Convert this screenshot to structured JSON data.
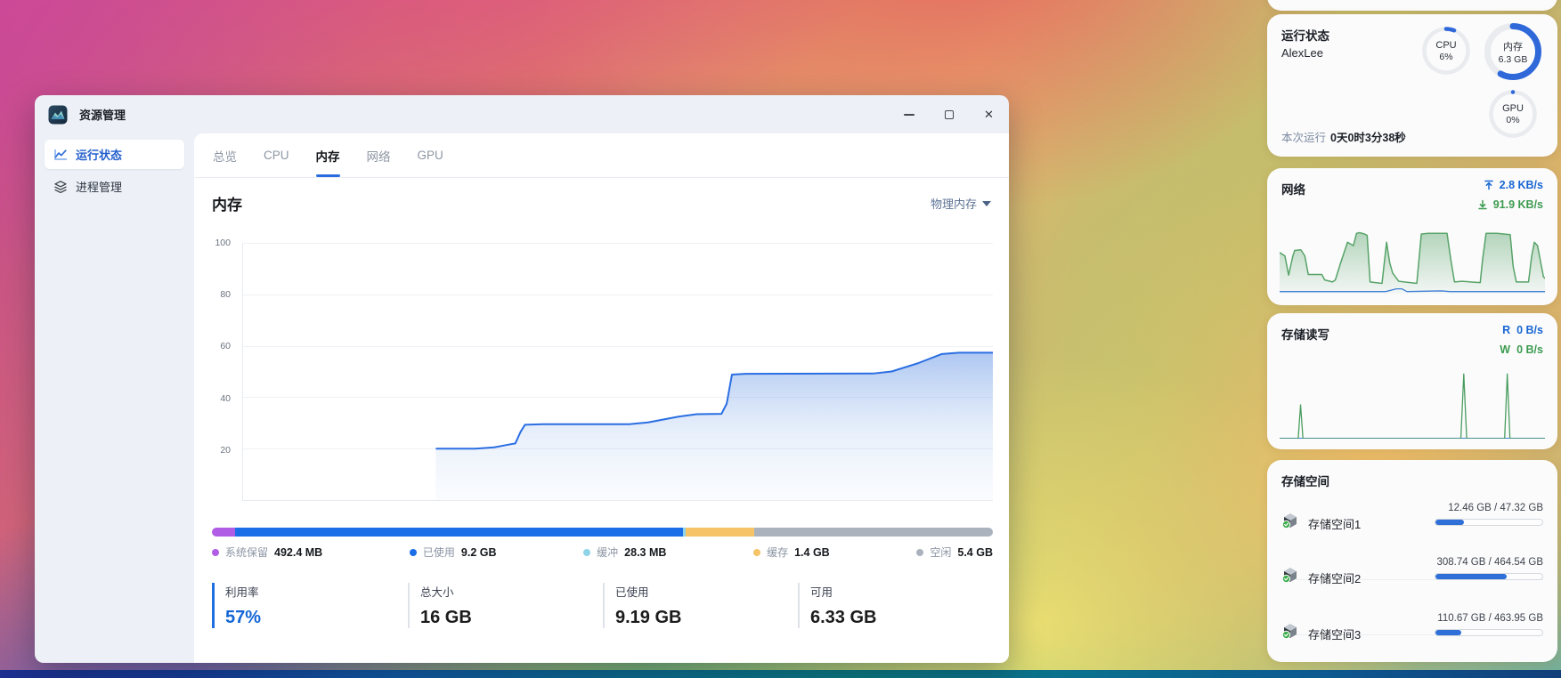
{
  "window": {
    "title": "资源管理",
    "sidebar": [
      {
        "label": "运行状态"
      },
      {
        "label": "进程管理"
      }
    ],
    "tabs": [
      {
        "label": "总览"
      },
      {
        "label": "CPU"
      },
      {
        "label": "内存"
      },
      {
        "label": "网络"
      },
      {
        "label": "GPU"
      }
    ],
    "active_tab": "内存",
    "memory": {
      "title": "内存",
      "selector": "物理内存",
      "legend": [
        {
          "label": "系统保留",
          "value": "492.4 MB",
          "color": "#b05ce4",
          "pct": 3
        },
        {
          "label": "已使用",
          "value": "9.2 GB",
          "color": "#1c6ee8",
          "pct": 57.3
        },
        {
          "label": "缓冲",
          "value": "28.3 MB",
          "color": "#8ed5ea",
          "pct": 0.4
        },
        {
          "label": "缓存",
          "value": "1.4 GB",
          "color": "#f6c366",
          "pct": 8.8
        },
        {
          "label": "空闲",
          "value": "5.4 GB",
          "color": "#aab3bd",
          "pct": 30.5
        }
      ],
      "stats": [
        {
          "label": "利用率",
          "value": "57%"
        },
        {
          "label": "总大小",
          "value": "16 GB"
        },
        {
          "label": "已使用",
          "value": "9.19 GB"
        },
        {
          "label": "可用",
          "value": "6.33 GB"
        }
      ]
    }
  },
  "widgets": {
    "status": {
      "title": "运行状态",
      "user": "AlexLee",
      "rings": [
        {
          "label": "CPU",
          "value": "6%",
          "pct": 6
        },
        {
          "label": "内存",
          "value": "6.3 GB",
          "pct": 58
        },
        {
          "label": "GPU",
          "value": "0%",
          "pct": 0
        }
      ],
      "uptime_label": "本次运行",
      "uptime_value": "0天0时3分38秒"
    },
    "network": {
      "title": "网络",
      "upload": "2.8 KB/s",
      "download": "91.9 KB/s"
    },
    "disk": {
      "title": "存储读写",
      "read_label": "R",
      "read": "0 B/s",
      "write_label": "W",
      "write": "0 B/s"
    },
    "storage": {
      "title": "存储空间",
      "volumes": [
        {
          "name": "存储空间1",
          "usage": "12.46 GB / 47.32 GB",
          "pct": 26.3
        },
        {
          "name": "存储空间2",
          "usage": "308.74 GB / 464.54 GB",
          "pct": 66.5
        },
        {
          "name": "存储空间3",
          "usage": "110.67 GB / 463.95 GB",
          "pct": 23.9
        }
      ]
    }
  },
  "chart_data": [
    {
      "id": "memory",
      "type": "area",
      "title": "内存 物理内存使用率",
      "ylabel": "%",
      "ylim": [
        0,
        100
      ],
      "yticks": [
        100,
        80,
        60,
        40,
        20
      ],
      "grid": true,
      "series": [
        {
          "name": "物理内存",
          "color": "#2a6ee2",
          "points": [
            [
              25.7,
              20
            ],
            [
              31,
              20
            ],
            [
              33.5,
              20.5
            ],
            [
              35.5,
              21.6
            ],
            [
              36.3,
              22
            ],
            [
              37,
              26.5
            ],
            [
              37.6,
              29.3
            ],
            [
              40,
              29.5
            ],
            [
              51.5,
              29.5
            ],
            [
              54,
              30.2
            ],
            [
              58,
              32.4
            ],
            [
              60.5,
              33.4
            ],
            [
              63.8,
              33.5
            ],
            [
              64.5,
              37.5
            ],
            [
              65.2,
              48.8
            ],
            [
              67,
              49.1
            ],
            [
              84,
              49.2
            ],
            [
              86.5,
              50
            ],
            [
              90,
              53.2
            ],
            [
              93.2,
              56.8
            ],
            [
              95.5,
              57.3
            ],
            [
              100,
              57.3
            ]
          ]
        }
      ]
    },
    {
      "id": "network",
      "type": "area",
      "title": "网络",
      "series": [
        {
          "name": "下载",
          "color": "#57a368",
          "points": [
            [
              0,
              60
            ],
            [
              2,
              55
            ],
            [
              3.4,
              27
            ],
            [
              5,
              55
            ],
            [
              5.7,
              63
            ],
            [
              8,
              64
            ],
            [
              9.5,
              55
            ],
            [
              10.8,
              28
            ],
            [
              15.9,
              28
            ],
            [
              17,
              20
            ],
            [
              19.9,
              17
            ],
            [
              21,
              20
            ],
            [
              23,
              45
            ],
            [
              25.6,
              75
            ],
            [
              27.8,
              70
            ],
            [
              29,
              88
            ],
            [
              30.1,
              89
            ],
            [
              32,
              87
            ],
            [
              33,
              85
            ],
            [
              34.1,
              17
            ],
            [
              38.6,
              15
            ],
            [
              40.3,
              75
            ],
            [
              41.5,
              45
            ],
            [
              42.6,
              30
            ],
            [
              44.9,
              18
            ],
            [
              51.7,
              15
            ],
            [
              53.4,
              87
            ],
            [
              56,
              88
            ],
            [
              63.1,
              88
            ],
            [
              64.5,
              50
            ],
            [
              65.9,
              17
            ],
            [
              68.8,
              18
            ],
            [
              75.6,
              16
            ],
            [
              76.5,
              50
            ],
            [
              77.8,
              88
            ],
            [
              82,
              88
            ],
            [
              86.9,
              86
            ],
            [
              88,
              40
            ],
            [
              89.2,
              17
            ],
            [
              93.8,
              17
            ],
            [
              95,
              55
            ],
            [
              96,
              75
            ],
            [
              97.2,
              70
            ],
            [
              99.4,
              25
            ],
            [
              100,
              22
            ]
          ]
        },
        {
          "name": "上传",
          "color": "#3f7fd6",
          "points": [
            [
              0,
              3
            ],
            [
              40,
              3
            ],
            [
              44,
              7
            ],
            [
              46,
              7
            ],
            [
              48,
              3
            ],
            [
              61,
              4
            ],
            [
              64,
              3
            ],
            [
              100,
              3
            ]
          ]
        }
      ]
    },
    {
      "id": "disk",
      "type": "line",
      "title": "存储读写",
      "series": [
        {
          "name": "写入",
          "color": "#4a9d5f",
          "points": [
            [
              0,
              0
            ],
            [
              7,
              0
            ],
            [
              7.9,
              48
            ],
            [
              8.8,
              0
            ],
            [
              68.3,
              0
            ],
            [
              69.4,
              92
            ],
            [
              70.5,
              0
            ],
            [
              84.8,
              0
            ],
            [
              85.8,
              92
            ],
            [
              86.8,
              0
            ],
            [
              100,
              0
            ]
          ]
        },
        {
          "name": "读取",
          "color": "#3f7fd6",
          "points": [
            [
              0,
              0.5
            ],
            [
              100,
              0.5
            ]
          ]
        }
      ]
    }
  ]
}
